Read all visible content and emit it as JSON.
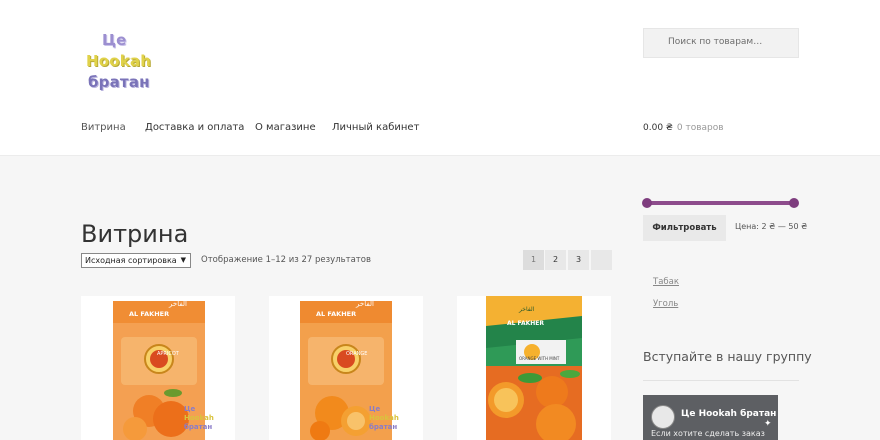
{
  "logo": {
    "line1": "Це",
    "line2": "Hookah",
    "line3": "братан"
  },
  "search": {
    "icon": "search-icon",
    "placeholder": "Поиск по товарам…"
  },
  "nav": {
    "items": [
      {
        "label": "Витрина",
        "current": true
      },
      {
        "label": "Доставка и оплата"
      },
      {
        "label": "О магазине"
      },
      {
        "label": "Личный кабинет"
      }
    ]
  },
  "cart": {
    "amount": "0.00 ₴",
    "count": "0 товаров",
    "icon": "cart-icon"
  },
  "page": {
    "title": "Витрина"
  },
  "shop": {
    "sort_label": "Исходная сортировка",
    "result_count": "Отображение 1–12 из 27 результатов",
    "pages": [
      "1",
      "2",
      "3"
    ],
    "next_icon": "next-page-icon"
  },
  "products": [
    {
      "brand": "AL FAKHER",
      "arabic": "الفاخر",
      "flavor": "APRICOT",
      "mark1": "Це",
      "mark2": "Hookah",
      "mark3": "братан"
    },
    {
      "brand": "AL FAKHER",
      "arabic": "الفاخر",
      "flavor": "ORANGE",
      "mark1": "Це",
      "mark2": "Hookah",
      "mark3": "братан"
    },
    {
      "brand": "AL FAKHER",
      "arabic": "الفاخر",
      "flavor": "ORANGE WITH MINT"
    }
  ],
  "sidebar": {
    "filter_button": "Фильтровать",
    "price_range": "Цена: 2 ₴ — 50 ₴",
    "price_min": 2,
    "price_max": 50,
    "categories": [
      "Табак",
      "Уголь"
    ],
    "group_title": "Вступайте в нашу группу",
    "fb_name": "Це Hookah братан",
    "fb_sub": "Если хотите сделать заказ"
  },
  "colors": {
    "accent": "#8d4c8c",
    "page_bg": "#f6f6f6",
    "fb_panel": "#5d5f63"
  }
}
